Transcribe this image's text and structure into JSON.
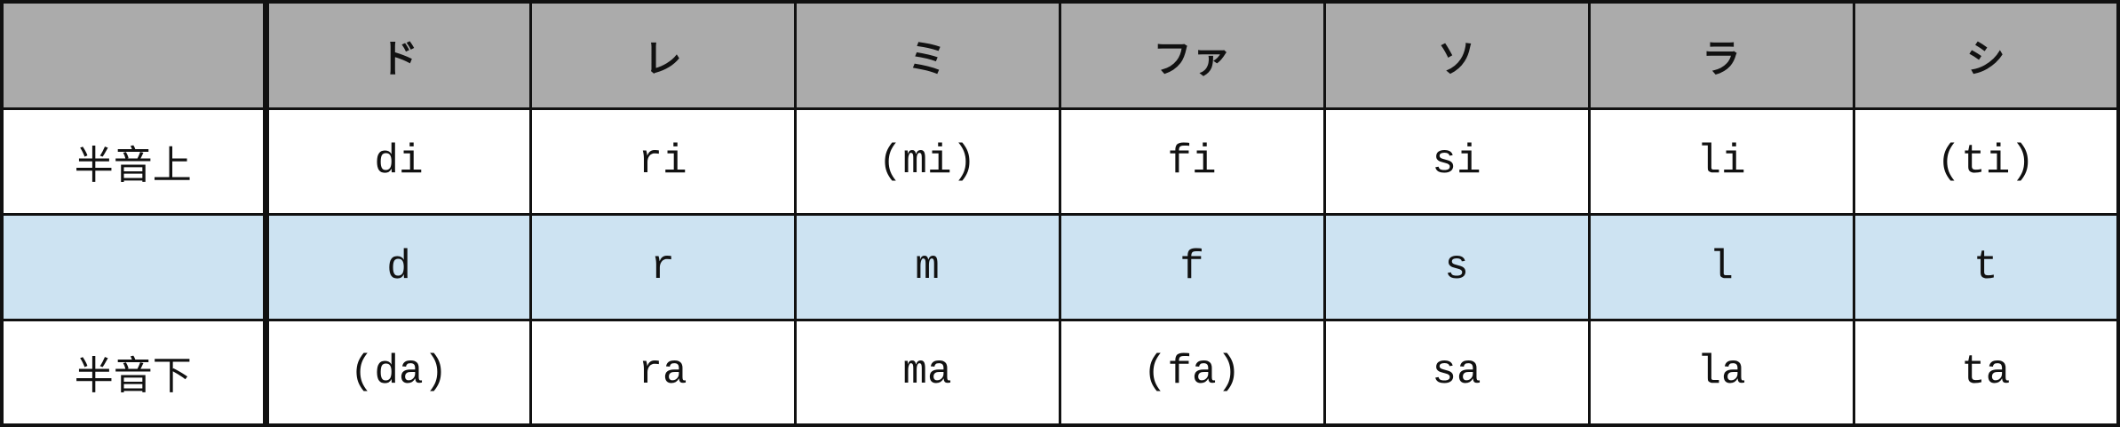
{
  "colors": {
    "header_bg": "#ababab",
    "base_row_bg": "#cde3f2",
    "row_bg": "#ffffff",
    "border": "#111111"
  },
  "header": {
    "corner": "",
    "notes": [
      "ド",
      "レ",
      "ミ",
      "ファ",
      "ソ",
      "ラ",
      "シ"
    ]
  },
  "rows": [
    {
      "label": "半音上",
      "cells": [
        "di",
        "ri",
        "(mi)",
        "fi",
        "si",
        "li",
        "(ti)"
      ]
    },
    {
      "label": "",
      "cells": [
        "d",
        "r",
        "m",
        "f",
        "s",
        "l",
        "t"
      ]
    },
    {
      "label": "半音下",
      "cells": [
        "(da)",
        "ra",
        "ma",
        "(fa)",
        "sa",
        "la",
        "ta"
      ]
    }
  ]
}
